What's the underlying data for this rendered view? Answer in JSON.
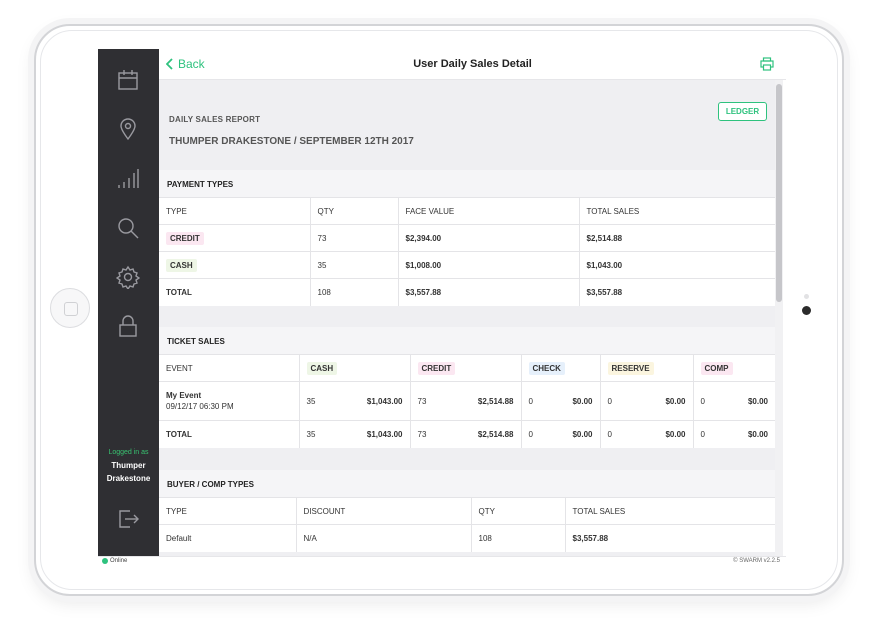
{
  "header": {
    "back_label": "Back",
    "title": "User Daily Sales Detail"
  },
  "report": {
    "label": "DAILY SALES REPORT",
    "subtitle": "THUMPER DRAKESTONE / SEPTEMBER 12TH 2017",
    "ledger_label": "LEDGER"
  },
  "sidebar": {
    "icons": [
      "calendar-icon",
      "location-pin-icon",
      "signal-bars-icon",
      "search-icon",
      "gear-icon",
      "lock-icon"
    ],
    "logged_in_label": "Logged in as",
    "user_first": "Thumper",
    "user_last": "Drakestone"
  },
  "payment_types": {
    "title": "PAYMENT TYPES",
    "headers": [
      "TYPE",
      "QTY",
      "FACE VALUE",
      "TOTAL SALES"
    ],
    "rows": [
      {
        "type": "CREDIT",
        "qty": "73",
        "face": "$2,394.00",
        "total": "$2,514.88"
      },
      {
        "type": "CASH",
        "qty": "35",
        "face": "$1,008.00",
        "total": "$1,043.00"
      },
      {
        "type": "TOTAL",
        "qty": "108",
        "face": "$3,557.88",
        "total": "$3,557.88"
      }
    ]
  },
  "ticket_sales": {
    "title": "TICKET SALES",
    "headers": [
      "EVENT",
      "CASH",
      "CREDIT",
      "CHECK",
      "RESERVE",
      "COMP"
    ],
    "event_row": {
      "name": "My Event",
      "date": "09/12/17 06:30 PM",
      "cash_qty": "35",
      "cash_amt": "$1,043.00",
      "credit_qty": "73",
      "credit_amt": "$2,514.88",
      "check_qty": "0",
      "check_amt": "$0.00",
      "reserve_qty": "0",
      "reserve_amt": "$0.00",
      "comp_qty": "0",
      "comp_amt": "$0.00"
    },
    "total_row": {
      "label": "TOTAL",
      "cash_qty": "35",
      "cash_amt": "$1,043.00",
      "credit_qty": "73",
      "credit_amt": "$2,514.88",
      "check_qty": "0",
      "check_amt": "$0.00",
      "reserve_qty": "0",
      "reserve_amt": "$0.00",
      "comp_qty": "0",
      "comp_amt": "$0.00"
    }
  },
  "buyer_comp": {
    "title": "BUYER / COMP TYPES",
    "headers": [
      "TYPE",
      "DISCOUNT",
      "QTY",
      "TOTAL SALES"
    ],
    "rows": [
      {
        "type": "Default",
        "discount": "N/A",
        "qty": "108",
        "total": "$3,557.88"
      }
    ]
  },
  "status": {
    "online": "Online",
    "version": "© SWARM v2.2.5"
  },
  "colors": {
    "accent": "#2ec27e",
    "sidebar": "#2f2f33"
  }
}
